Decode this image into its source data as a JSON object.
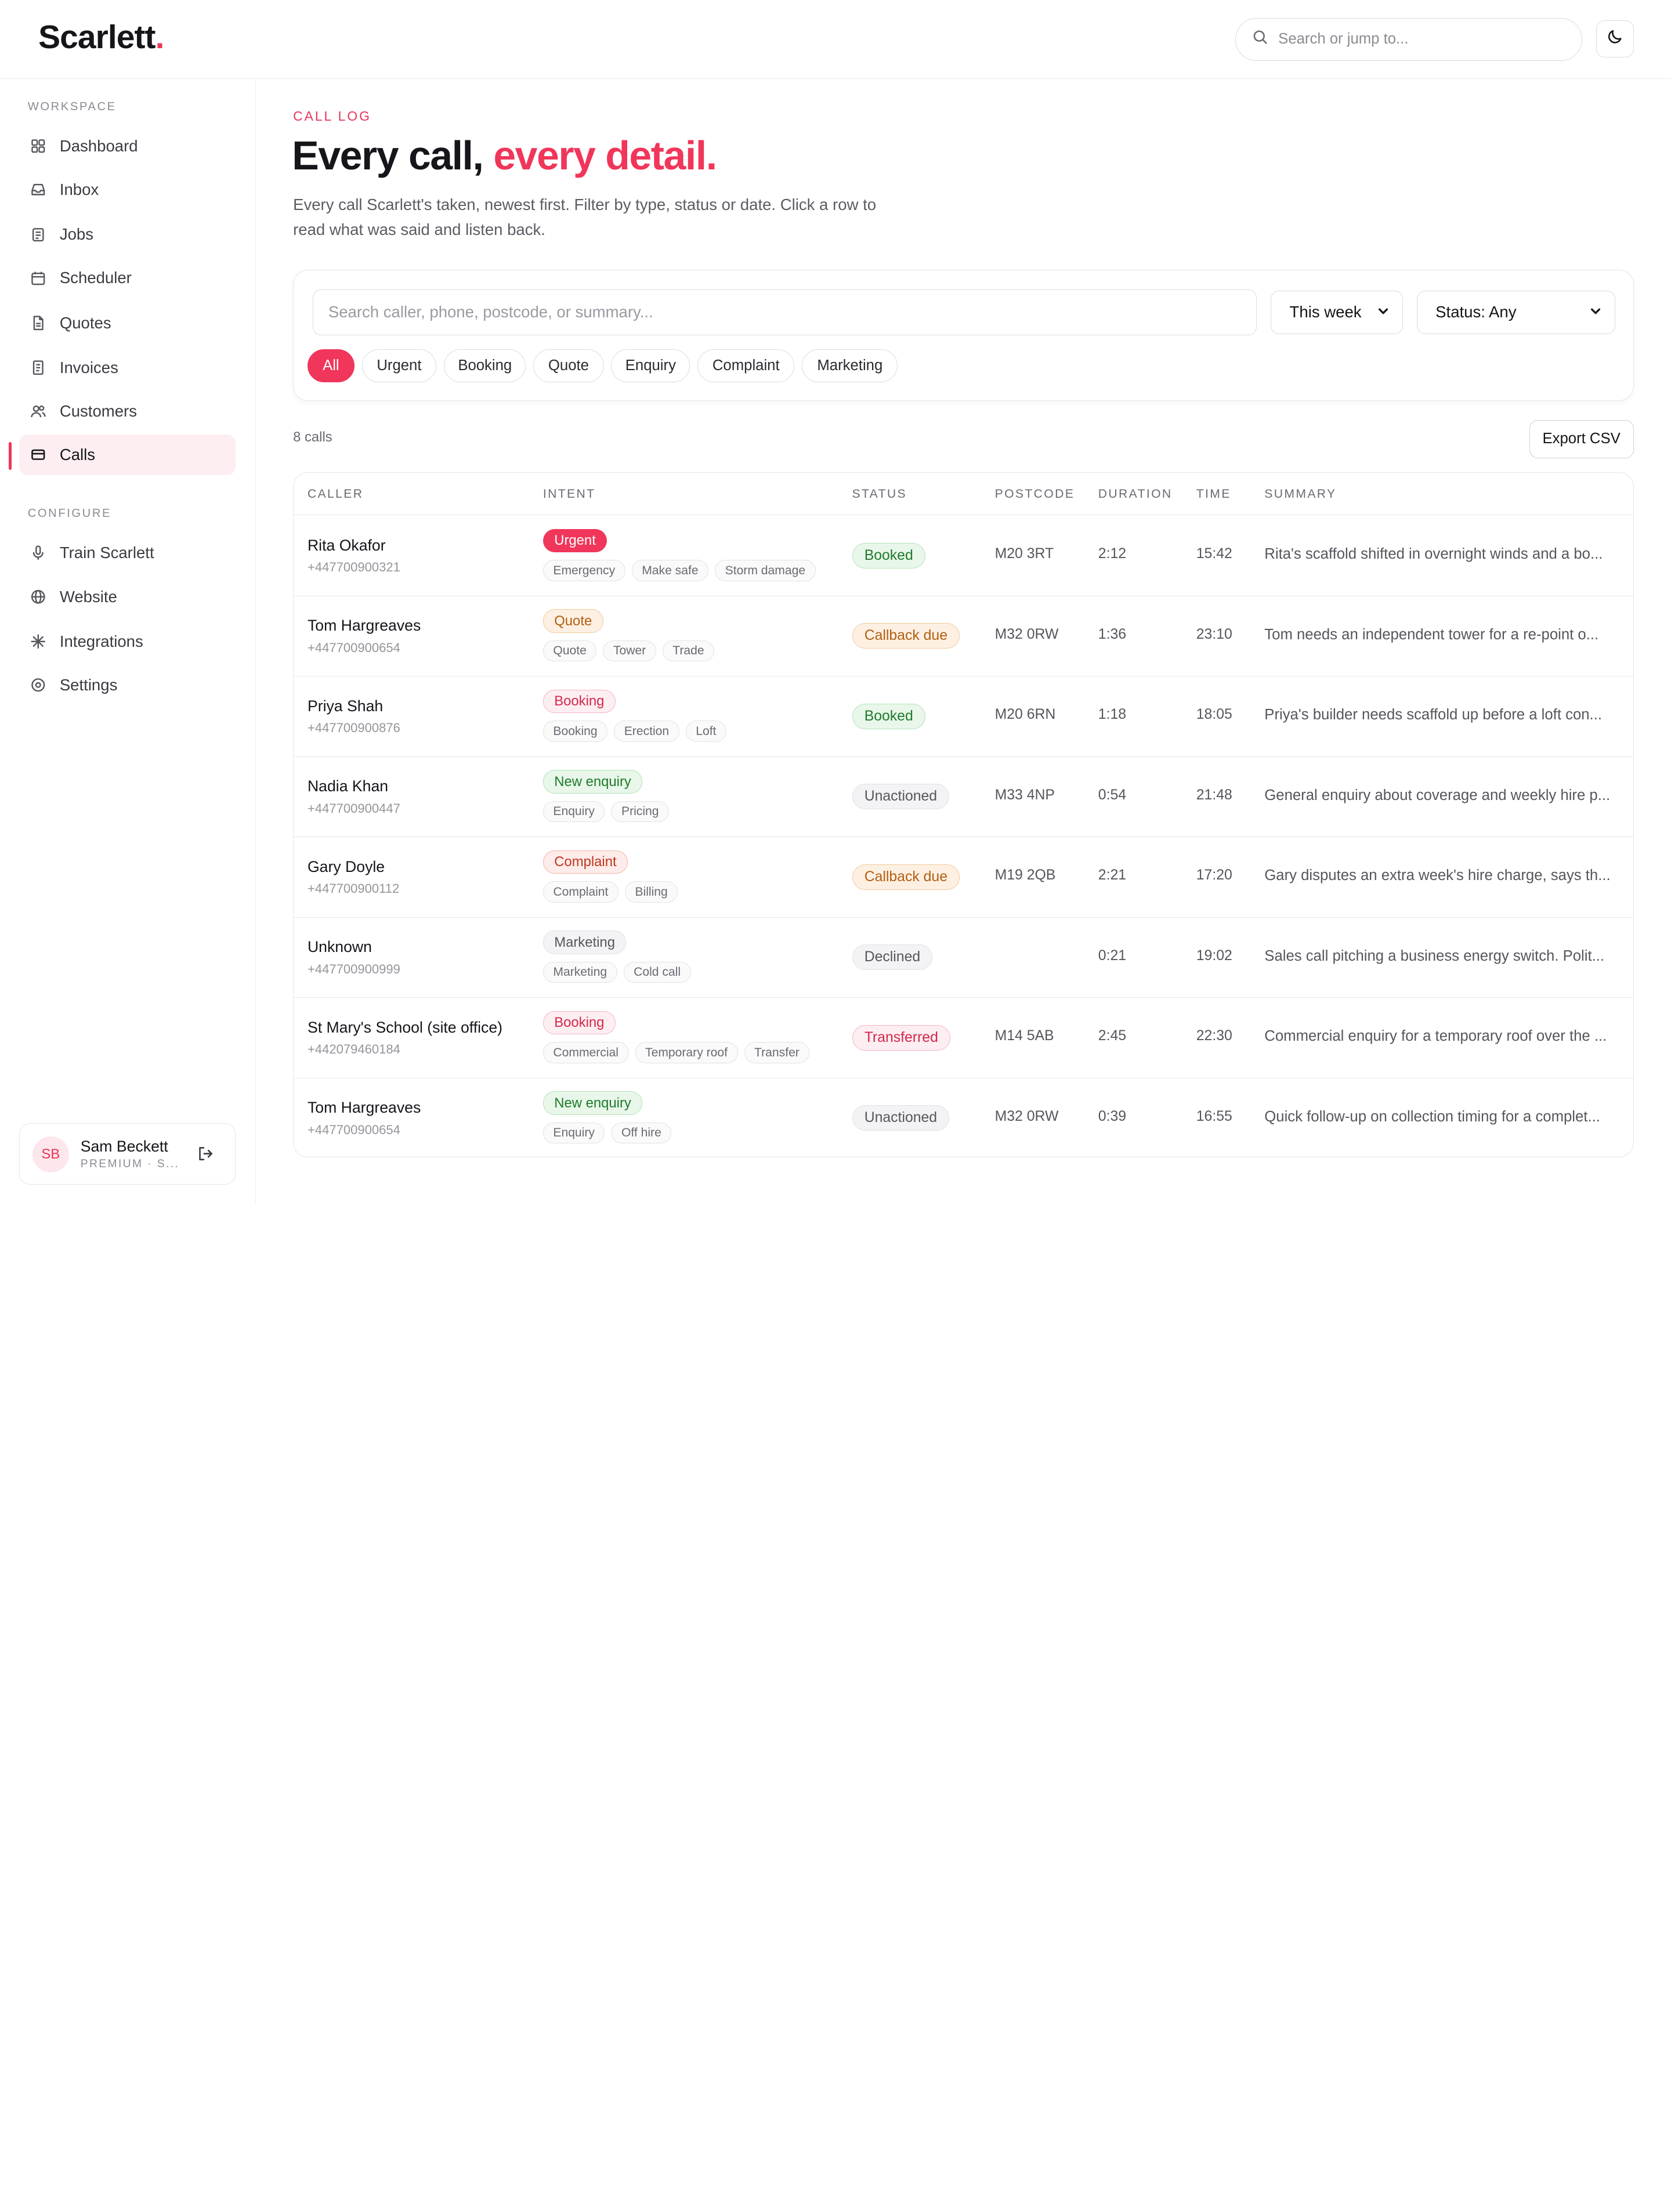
{
  "brand": {
    "name": "Scarlett",
    "dot": "."
  },
  "topbar": {
    "search_placeholder": "Search or jump to..."
  },
  "sidebar": {
    "workspace_label": "WORKSPACE",
    "workspace_items": [
      {
        "label": "Dashboard",
        "icon": "grid-icon"
      },
      {
        "label": "Inbox",
        "icon": "inbox-icon"
      },
      {
        "label": "Jobs",
        "icon": "clipboard-icon"
      },
      {
        "label": "Scheduler",
        "icon": "calendar-icon"
      },
      {
        "label": "Quotes",
        "icon": "document-icon"
      },
      {
        "label": "Invoices",
        "icon": "receipt-icon"
      },
      {
        "label": "Customers",
        "icon": "users-icon"
      },
      {
        "label": "Calls",
        "icon": "calls-icon",
        "active": true
      }
    ],
    "configure_label": "CONFIGURE",
    "configure_items": [
      {
        "label": "Train Scarlett",
        "icon": "microphone-icon"
      },
      {
        "label": "Website",
        "icon": "globe-icon"
      },
      {
        "label": "Integrations",
        "icon": "sparkle-icon"
      },
      {
        "label": "Settings",
        "icon": "settings-icon"
      }
    ],
    "user": {
      "initials": "SB",
      "name": "Sam Beckett",
      "plan": "PREMIUM · S..."
    }
  },
  "main": {
    "eyebrow": "CALL LOG",
    "title_start": "Every call, ",
    "title_accent": "every detail.",
    "subtitle": "Every call Scarlett's taken, newest first. Filter by type, status or date. Click a row to read what was said and listen back.",
    "search_placeholder": "Search caller, phone, postcode, or summary...",
    "date_filter": "This week",
    "status_filter": "Status: Any",
    "chips": [
      "All",
      "Urgent",
      "Booking",
      "Quote",
      "Enquiry",
      "Complaint",
      "Marketing"
    ],
    "count": "8 calls",
    "export_label": "Export CSV"
  },
  "table": {
    "headers": [
      "CALLER",
      "INTENT",
      "STATUS",
      "POSTCODE",
      "DURATION",
      "TIME",
      "SUMMARY"
    ],
    "rows": [
      {
        "caller": "Rita Okafor",
        "phone": "+447700900321",
        "intent": "Urgent",
        "intent_style": "urgent-p",
        "tags": [
          "Emergency",
          "Make safe",
          "Storm damage"
        ],
        "status": "Booked",
        "status_style": "st-booked",
        "postcode": "M20 3RT",
        "duration": "2:12",
        "time": "15:42",
        "summary": "Rita's scaffold shifted in overnight winds and a bo..."
      },
      {
        "caller": "Tom Hargreaves",
        "phone": "+447700900654",
        "intent": "Quote",
        "intent_style": "quote-p",
        "tags": [
          "Quote",
          "Tower",
          "Trade"
        ],
        "status": "Callback due",
        "status_style": "st-callback",
        "postcode": "M32 0RW",
        "duration": "1:36",
        "time": "23:10",
        "summary": "Tom needs an independent tower for a re-point o..."
      },
      {
        "caller": "Priya Shah",
        "phone": "+447700900876",
        "intent": "Booking",
        "intent_style": "booking-p",
        "tags": [
          "Booking",
          "Erection",
          "Loft"
        ],
        "status": "Booked",
        "status_style": "st-booked",
        "postcode": "M20 6RN",
        "duration": "1:18",
        "time": "18:05",
        "summary": "Priya's builder needs scaffold up before a loft con..."
      },
      {
        "caller": "Nadia Khan",
        "phone": "+447700900447",
        "intent": "New enquiry",
        "intent_style": "enq-p",
        "tags": [
          "Enquiry",
          "Pricing"
        ],
        "status": "Unactioned",
        "status_style": "st-unact",
        "postcode": "M33 4NP",
        "duration": "0:54",
        "time": "21:48",
        "summary": "General enquiry about coverage and weekly hire p..."
      },
      {
        "caller": "Gary Doyle",
        "phone": "+447700900112",
        "intent": "Complaint",
        "intent_style": "comp-p",
        "tags": [
          "Complaint",
          "Billing"
        ],
        "status": "Callback due",
        "status_style": "st-callback",
        "postcode": "M19 2QB",
        "duration": "2:21",
        "time": "17:20",
        "summary": "Gary disputes an extra week's hire charge, says th..."
      },
      {
        "caller": "Unknown",
        "phone": "+447700900999",
        "intent": "Marketing",
        "intent_style": "mkt-p",
        "tags": [
          "Marketing",
          "Cold call"
        ],
        "status": "Declined",
        "status_style": "st-declined",
        "postcode": "",
        "duration": "0:21",
        "time": "19:02",
        "summary": "Sales call pitching a business energy switch. Polit..."
      },
      {
        "caller": "St Mary's School (site office)",
        "phone": "+442079460184",
        "intent": "Booking",
        "intent_style": "booking-p",
        "tags": [
          "Commercial",
          "Temporary roof",
          "Transfer"
        ],
        "status": "Transferred",
        "status_style": "st-transfer",
        "postcode": "M14 5AB",
        "duration": "2:45",
        "time": "22:30",
        "summary": "Commercial enquiry for a temporary roof over the ..."
      },
      {
        "caller": "Tom Hargreaves",
        "phone": "+447700900654",
        "intent": "New enquiry",
        "intent_style": "enq-p",
        "tags": [
          "Enquiry",
          "Off hire"
        ],
        "status": "Unactioned",
        "status_style": "st-unact",
        "postcode": "M32 0RW",
        "duration": "0:39",
        "time": "16:55",
        "summary": "Quick follow-up on collection timing for a complet..."
      }
    ]
  }
}
